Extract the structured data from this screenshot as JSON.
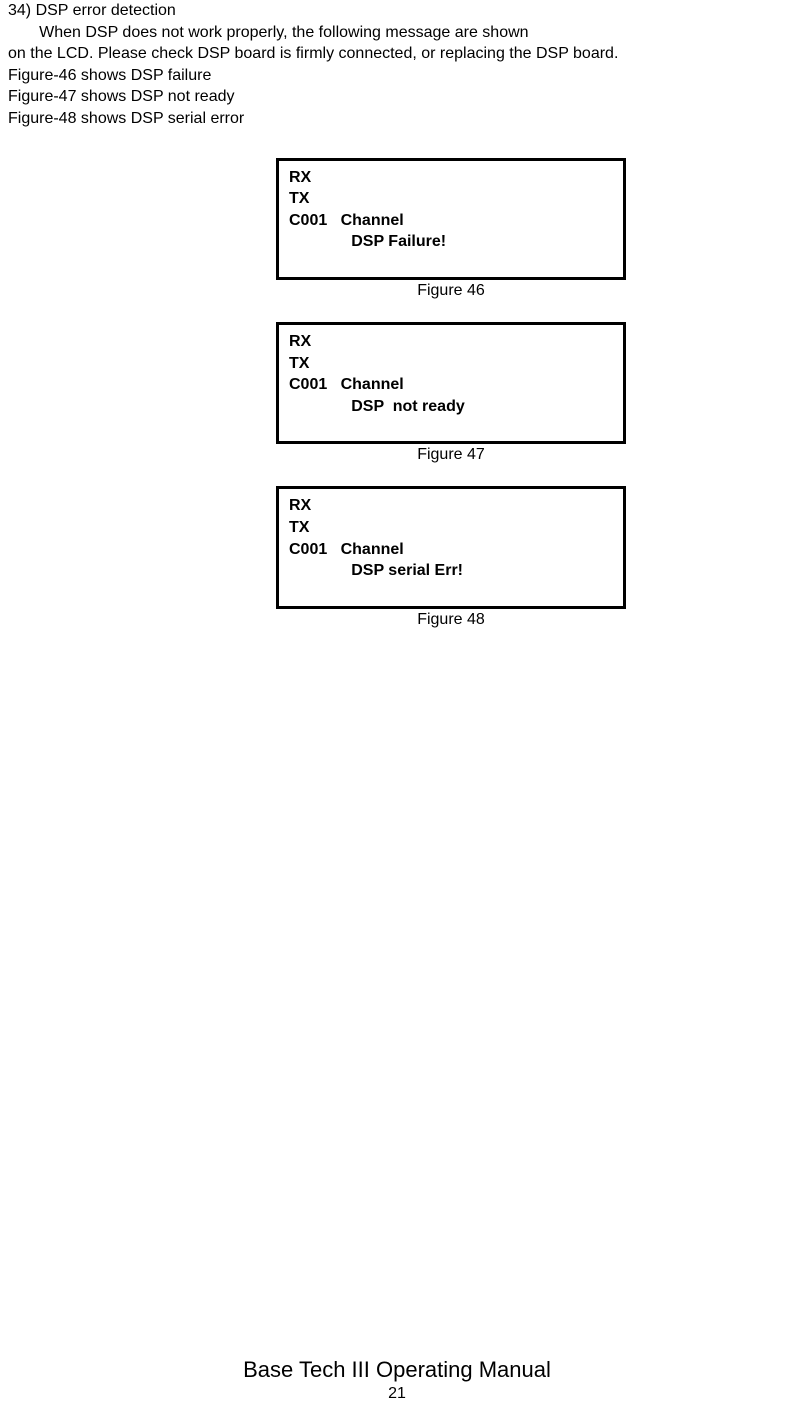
{
  "intro": {
    "line1": "34) DSP error detection",
    "line2": "       When DSP does not work properly, the following message are shown",
    "line3": "on the LCD. Please check DSP board is firmly connected, or replacing the DSP board.",
    "line4": "Figure-46 shows DSP failure",
    "line5": "Figure-47 shows DSP not ready",
    "line6": "Figure-48 shows DSP serial error"
  },
  "lcd1": {
    "l1": "RX",
    "l2": "TX",
    "l3": "C001   Channel",
    "l4": "              DSP Failure!"
  },
  "caption1": "Figure 46",
  "lcd2": {
    "l1": "RX",
    "l2": "TX",
    "l3": "C001   Channel",
    "l4": "              DSP  not ready"
  },
  "caption2": "Figure 47",
  "lcd3": {
    "l1": "RX",
    "l2": "TX",
    "l3": "C001   Channel",
    "l4": "              DSP serial Err!"
  },
  "caption3": "Figure 48",
  "footer": {
    "title": "Base Tech III Operating Manual",
    "page": "21"
  }
}
